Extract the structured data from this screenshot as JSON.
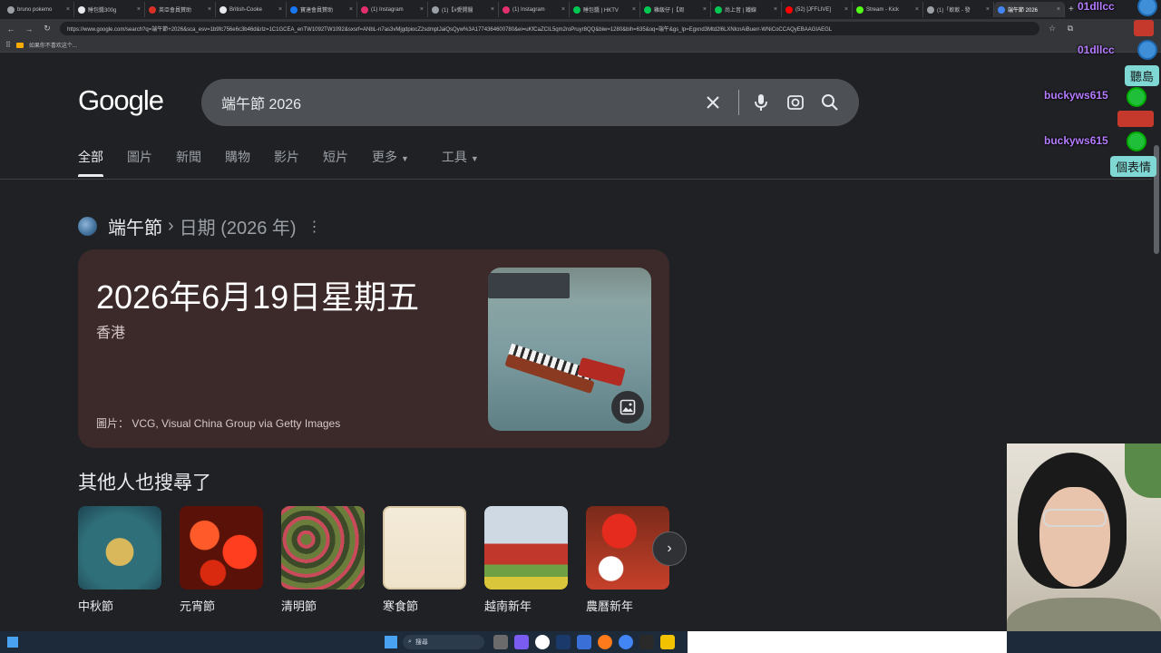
{
  "browser": {
    "tabs": [
      {
        "label": "bruno pokemo",
        "color": "#9aa0a6"
      },
      {
        "label": "睡包醬300g",
        "color": "#e8eaed"
      },
      {
        "label": "英亞會員贊助",
        "color": "#d93025"
      },
      {
        "label": "British-Cooke",
        "color": "#e8eaed"
      },
      {
        "label": "寶達會員贊助",
        "color": "#1877f2"
      },
      {
        "label": "(1) Instagram",
        "color": "#e1306c"
      },
      {
        "label": "(1)【#愛開醫",
        "color": "#9aa0a6"
      },
      {
        "label": "(1) Instagram",
        "color": "#e1306c"
      },
      {
        "label": "睡包醬 | HKTV",
        "color": "#00c853"
      },
      {
        "label": "雞飯仔 |【周",
        "color": "#00c853"
      },
      {
        "label": "尚上音 | 鐵線",
        "color": "#00c853"
      },
      {
        "label": "(52) [JFFLIVE]",
        "color": "#ff0000"
      },
      {
        "label": "Stream - Kick",
        "color": "#53fc18"
      },
      {
        "label": "(1)「軟軟 - 發",
        "color": "#9aa0a6"
      },
      {
        "label": "端午節 2026",
        "color": "#4285f4",
        "active": true
      }
    ],
    "url": "https://www.google.com/search?q=端午節+2026&sca_esv=1b9fc756e6c3b46d&rlz=1C1GCEA_enTW1092TW1092&sxsrf=ANbL-n7as3vMjgdpiocZ2sdmptJaiQsQyw%3A1774364600780&ei=uKfCaZCIL5qm2roPruyr8QQ&biw=1280&bih=635&oq=端午&gs_lp=Egxnd3Mtd2l6LXNlcnAiBuerr-WNiCoCCAQyEBAAGIAEGL",
    "bookmark": "如果你不喜欢这个..."
  },
  "google": {
    "logo": "Google",
    "query": "端午節 2026",
    "tabs": [
      "全部",
      "圖片",
      "新聞",
      "購物",
      "影片",
      "短片",
      "更多",
      "工具"
    ]
  },
  "answer": {
    "topic": "端午節",
    "separator": "›",
    "subtopic": "日期 (2026 年)",
    "date": "2026年6月19日星期五",
    "location": "香港",
    "credit": "圖片： VCG, Visual China Group via Getty Images"
  },
  "related": {
    "title": "其他人也搜尋了",
    "items": [
      {
        "label": "中秋節"
      },
      {
        "label": "元宵節"
      },
      {
        "label": "清明節"
      },
      {
        "label": "寒食節"
      },
      {
        "label": "越南新年"
      },
      {
        "label": "農曆新年"
      }
    ]
  },
  "chat": {
    "messages": [
      {
        "user": "01dllcc"
      },
      {
        "user": "01dllcc",
        "text": "聽島"
      },
      {
        "user": "buckyws615"
      },
      {
        "user": "buckyws615",
        "text": "個表情"
      }
    ]
  },
  "taskbar": {
    "search_label": "搜尋"
  },
  "colors": {
    "background": "#202124",
    "card": "#3c2a2b",
    "searchbox": "#4d5156",
    "chat_user": "#b57cff",
    "chat_bubble": "#7fd8d4"
  }
}
